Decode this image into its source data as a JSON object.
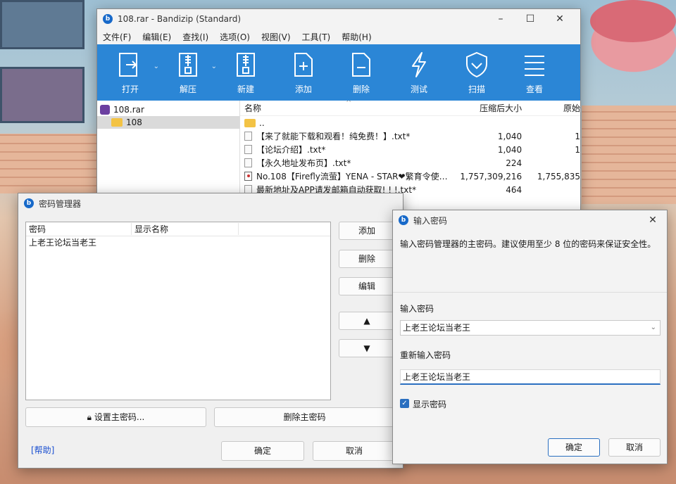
{
  "main_window": {
    "title": "108.rar - Bandizip (Standard)",
    "menu": [
      "文件(F)",
      "编辑(E)",
      "查找(I)",
      "选项(O)",
      "视图(V)",
      "工具(T)",
      "帮助(H)"
    ],
    "toolbar": [
      {
        "label": "打开",
        "icon": "open-icon"
      },
      {
        "label": "解压",
        "icon": "extract-icon"
      },
      {
        "label": "新建",
        "icon": "new-archive-icon"
      },
      {
        "label": "添加",
        "icon": "add-file-icon"
      },
      {
        "label": "删除",
        "icon": "delete-file-icon"
      },
      {
        "label": "测试",
        "icon": "test-icon"
      },
      {
        "label": "扫描",
        "icon": "scan-shield-icon"
      },
      {
        "label": "查看",
        "icon": "view-menu-icon"
      }
    ],
    "tree": {
      "archive": "108.rar",
      "folder": "108"
    },
    "file_columns": {
      "name": "名称",
      "packed": "压缩后大小",
      "original": "原始"
    },
    "files": [
      {
        "name": "..",
        "packed": "",
        "original": "",
        "kind": "folder"
      },
      {
        "name": "【来了就能下载和观看！纯免费！】.txt*",
        "packed": "1,040",
        "original": "1",
        "kind": "txt"
      },
      {
        "name": "【论坛介绍】.txt*",
        "packed": "1,040",
        "original": "1",
        "kind": "txt"
      },
      {
        "name": "【永久地址发布页】.txt*",
        "packed": "224",
        "original": "",
        "kind": "txt"
      },
      {
        "name": "No.108【Firefly流萤】YENA - STAR❤繁育令使…",
        "packed": "1,757,309,216",
        "original": "1,755,835",
        "kind": "video"
      },
      {
        "name": "最新地址及APP请发邮箱自动获取! ! !.txt*",
        "packed": "464",
        "original": "",
        "kind": "txt"
      }
    ]
  },
  "password_manager": {
    "title": "密码管理器",
    "columns": {
      "password": "密码",
      "display_name": "显示名称"
    },
    "rows": [
      "上老王论坛当老王"
    ],
    "buttons": {
      "add": "添加",
      "delete": "删除",
      "edit": "编辑",
      "up": "▲",
      "down": "▼"
    },
    "set_master": "设置主密码...",
    "delete_master": "删除主密码",
    "help": "[帮助]",
    "ok": "确定",
    "cancel": "取消"
  },
  "enter_password": {
    "title": "输入密码",
    "description": "输入密码管理器的主密码。建议使用至少 8 位的密码来保证安全性。",
    "label_password": "输入密码",
    "password_value": "上老王论坛当老王",
    "label_repeat": "重新输入密码",
    "repeat_value": "上老王论坛当老王",
    "show_password": "显示密码",
    "ok": "确定",
    "cancel": "取消"
  }
}
